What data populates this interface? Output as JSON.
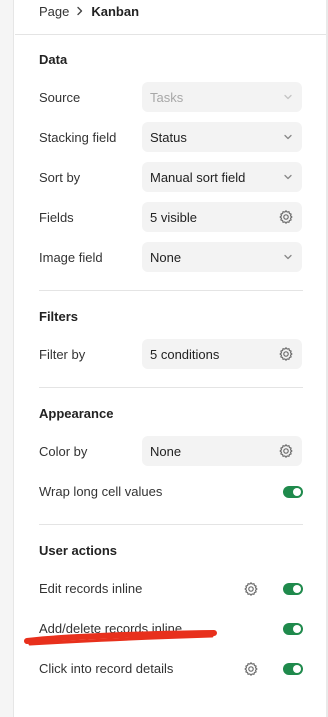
{
  "breadcrumb": {
    "parent": "Page",
    "current": "Kanban"
  },
  "data_section": {
    "title": "Data",
    "source": {
      "label": "Source",
      "value": "Tasks"
    },
    "stacking": {
      "label": "Stacking field",
      "value": "Status"
    },
    "sort": {
      "label": "Sort by",
      "value": "Manual sort field"
    },
    "fields": {
      "label": "Fields",
      "value": "5 visible"
    },
    "image": {
      "label": "Image field",
      "value": "None"
    }
  },
  "filters_section": {
    "title": "Filters",
    "filter": {
      "label": "Filter by",
      "value": "5 conditions"
    }
  },
  "appearance_section": {
    "title": "Appearance",
    "color": {
      "label": "Color by",
      "value": "None"
    },
    "wrap": {
      "label": "Wrap long cell values",
      "on": true
    }
  },
  "actions_section": {
    "title": "User actions",
    "edit": {
      "label": "Edit records inline",
      "on": true
    },
    "adddelete": {
      "label": "Add/delete records inline",
      "on": true
    },
    "click": {
      "label": "Click into record details",
      "on": true
    }
  },
  "colors": {
    "toggle_on": "#1f8a4c",
    "annotation": "#e8301c"
  }
}
